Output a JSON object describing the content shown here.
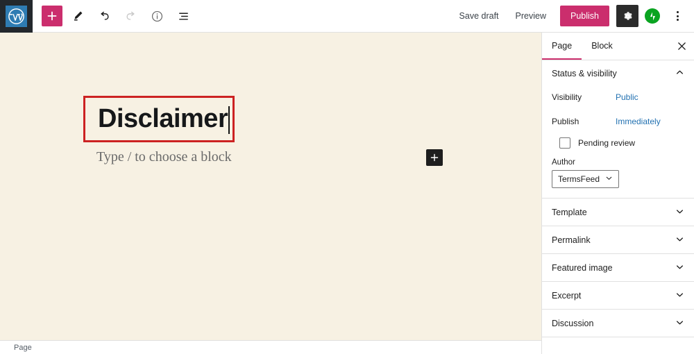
{
  "topbar": {
    "logo_icon": "wordpress-logo-icon",
    "tools": [
      {
        "name": "add-block-button",
        "icon": "plus-icon",
        "label": "+",
        "disabled": false
      },
      {
        "name": "edit-tool-button",
        "icon": "pencil-icon",
        "label": "",
        "disabled": false
      },
      {
        "name": "undo-button",
        "icon": "undo-arrow-icon",
        "label": "",
        "disabled": false
      },
      {
        "name": "redo-button",
        "icon": "redo-arrow-icon",
        "label": "",
        "disabled": true
      },
      {
        "name": "details-button",
        "icon": "info-circle-icon",
        "label": "",
        "disabled": false
      },
      {
        "name": "list-view-button",
        "icon": "list-view-icon",
        "label": "",
        "disabled": false
      }
    ],
    "save_draft_label": "Save draft",
    "preview_label": "Preview",
    "publish_label": "Publish",
    "settings_icon": "gear-icon",
    "jetpack_icon": "jetpack-icon",
    "more_menu_icon": "kebab-menu-icon",
    "accent_color": "#cb2e6d"
  },
  "editor": {
    "title": "Disclaimer",
    "block_placeholder": "Type / to choose a block",
    "inserter_icon": "plus-icon",
    "canvas_color": "#f7f1e3",
    "highlight_color": "#cc2222",
    "statusbar_breadcrumb": "Page"
  },
  "sidebar": {
    "tabs": [
      {
        "label": "Page",
        "active": true
      },
      {
        "label": "Block",
        "active": false
      }
    ],
    "close_icon": "close-icon",
    "status_panel": {
      "title": "Status & visibility",
      "chevron_icon": "chevron-up-icon",
      "visibility_label": "Visibility",
      "visibility_value": "Public",
      "publish_label": "Publish",
      "publish_value": "Immediately",
      "pending_review_label": "Pending review",
      "pending_review_checked": false,
      "author_label": "Author",
      "author_value": "TermsFeed",
      "author_chevron_icon": "chevron-down-icon"
    },
    "panels": [
      {
        "label": "Template",
        "chevron_icon": "chevron-down-icon"
      },
      {
        "label": "Permalink",
        "chevron_icon": "chevron-down-icon"
      },
      {
        "label": "Featured image",
        "chevron_icon": "chevron-down-icon"
      },
      {
        "label": "Excerpt",
        "chevron_icon": "chevron-down-icon"
      },
      {
        "label": "Discussion",
        "chevron_icon": "chevron-down-icon"
      }
    ]
  }
}
